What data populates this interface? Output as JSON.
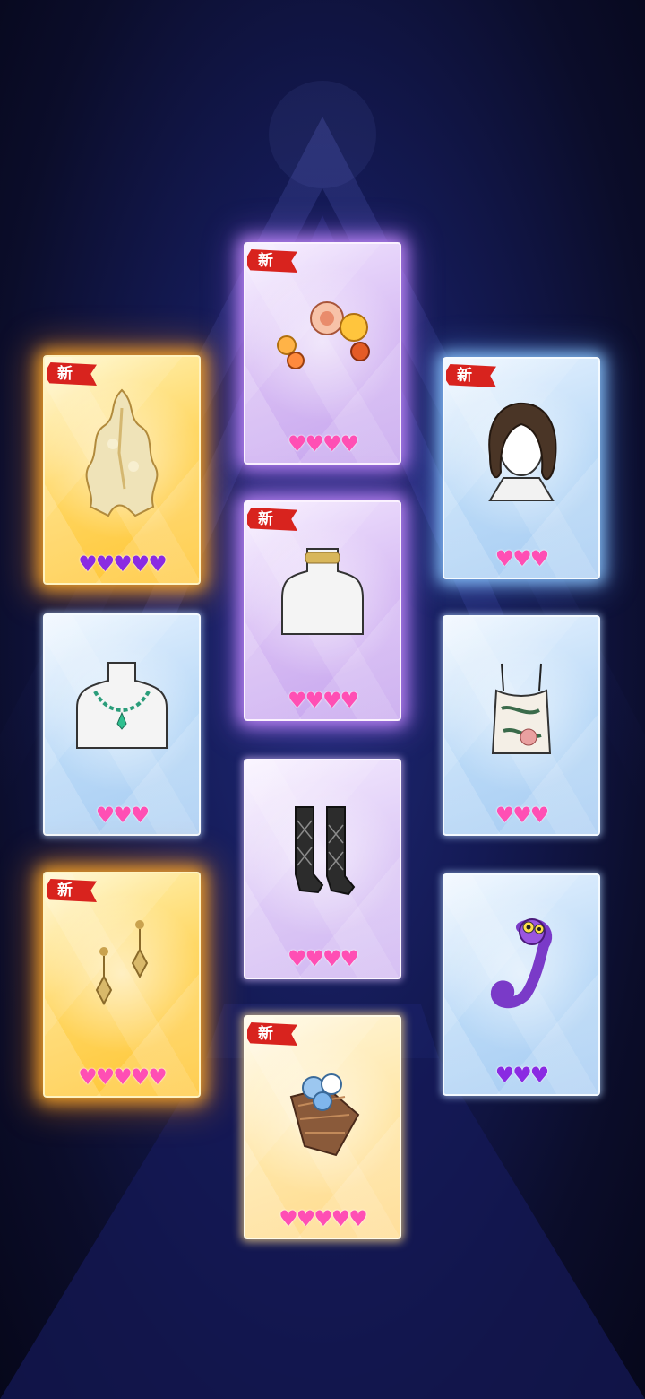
{
  "new_label": "新",
  "heart_glyph": "♥",
  "colors": {
    "heart_pink": "#ff4fb4",
    "heart_purple": "#8a2be2",
    "new_badge": "#d8231e"
  },
  "cards": [
    {
      "item": "gold-lace-ornament",
      "rarity": "gold",
      "is_new": true,
      "hearts": 5,
      "heart_color": "purple"
    },
    {
      "item": "flower-hairpins",
      "rarity": "purple",
      "is_new": true,
      "hearts": 4,
      "heart_color": "pink"
    },
    {
      "item": "short-brown-hair",
      "rarity": "blue",
      "is_new": true,
      "hearts": 3,
      "heart_color": "pink"
    },
    {
      "item": "emerald-necklace",
      "rarity": "blue",
      "is_new": false,
      "hearts": 3,
      "heart_color": "pink"
    },
    {
      "item": "gold-choker",
      "rarity": "purple",
      "is_new": true,
      "hearts": 4,
      "heart_color": "pink"
    },
    {
      "item": "floral-camisole",
      "rarity": "blue",
      "is_new": false,
      "hearts": 3,
      "heart_color": "pink"
    },
    {
      "item": "gold-earrings",
      "rarity": "gold",
      "is_new": true,
      "hearts": 5,
      "heart_color": "pink"
    },
    {
      "item": "argyle-socks",
      "rarity": "lilac",
      "is_new": false,
      "hearts": 4,
      "heart_color": "pink"
    },
    {
      "item": "purple-chameleon",
      "rarity": "blue",
      "is_new": false,
      "hearts": 3,
      "heart_color": "purple"
    },
    {
      "item": "flower-basket-bag",
      "rarity": "cream",
      "is_new": true,
      "hearts": 5,
      "heart_color": "pink"
    }
  ]
}
